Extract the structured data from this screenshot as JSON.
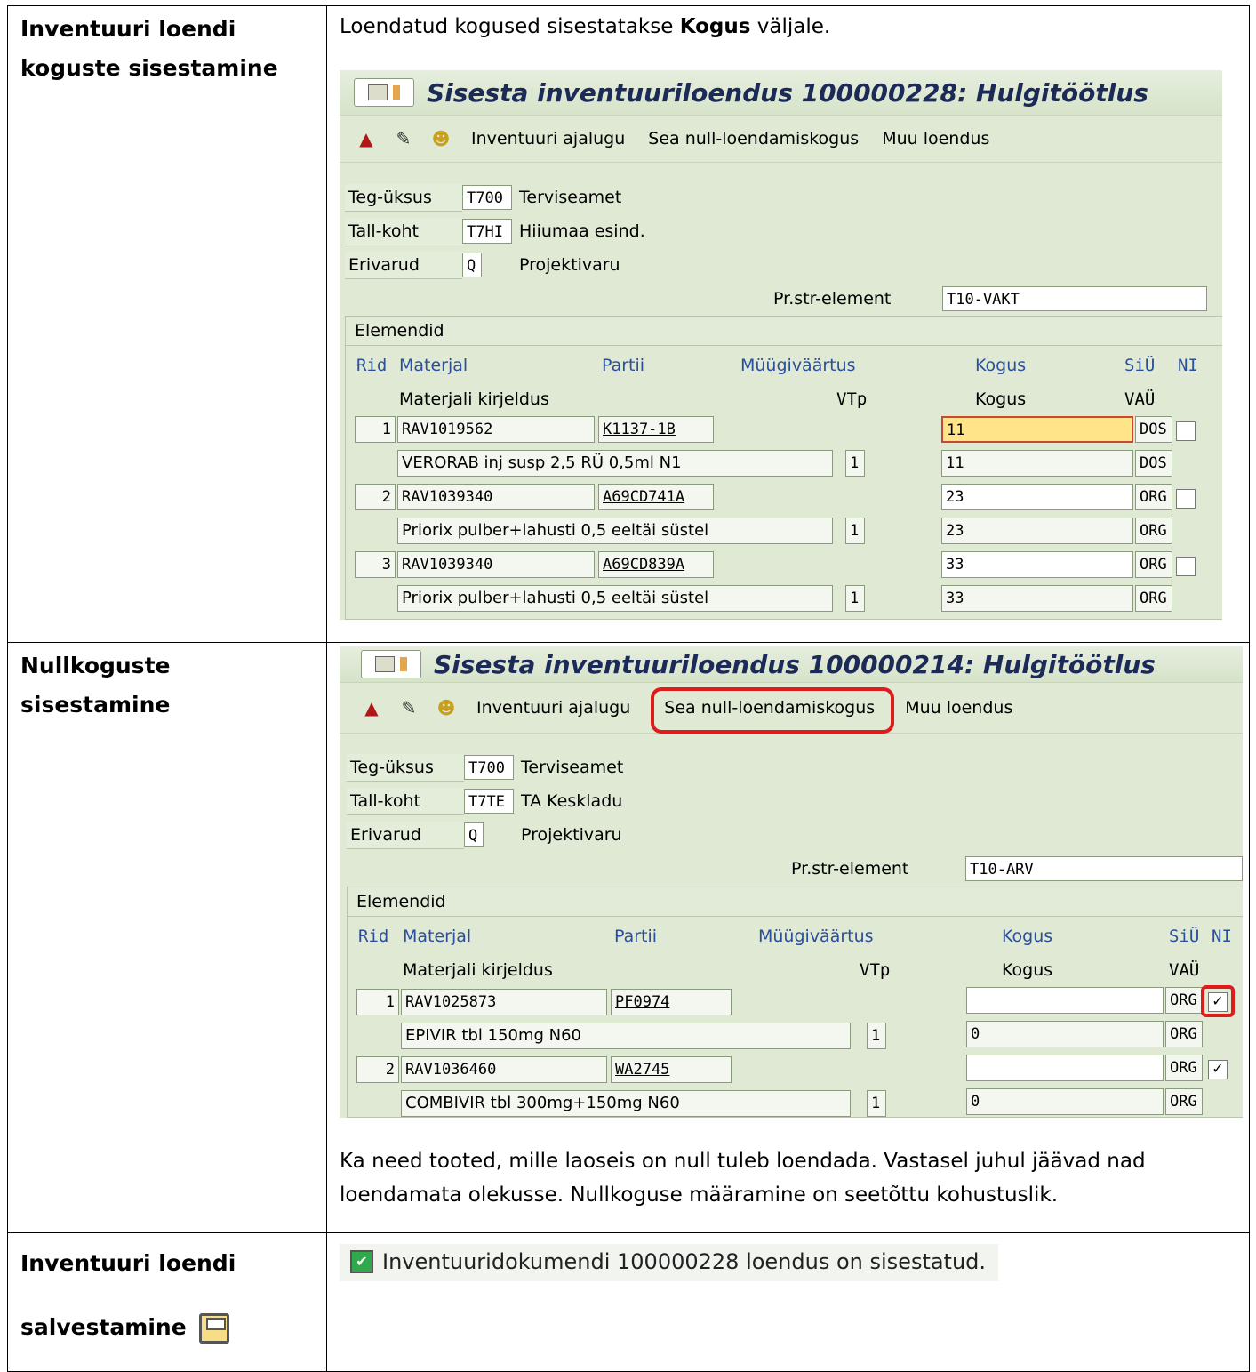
{
  "rows": [
    {
      "label": "Inventuuri loendi koguste sisestamine",
      "intro_pre": "Loendatud kogused sisestatakse ",
      "intro_bold": "Kogus",
      "intro_post": " väljale.",
      "screen": {
        "title": "Sisesta inventuuriloendus 100000228: Hulgitöötlus",
        "toolbar": [
          "Inventuuri ajalugu",
          "Sea null-loendamiskogus",
          "Muu loendus"
        ],
        "fields": [
          {
            "label": "Teg-üksus",
            "code": "T700",
            "text": "Terviseamet"
          },
          {
            "label": "Tall-koht",
            "code": "T7HI",
            "text": "Hiiumaa esind."
          },
          {
            "label": "Erivarud",
            "code": "Q",
            "text": "Projektivaru"
          }
        ],
        "psp_label": "Pr.str-element",
        "psp_value": "T10-VAKT",
        "group_title": "Elemendid",
        "col_headers": {
          "rid": "Rid",
          "materjal": "Materjal",
          "partii": "Partii",
          "muugi": "Müügiväärtus",
          "kogus": "Kogus",
          "siu": "SiÜ",
          "ni": "NI",
          "kirjeldus": "Materjali kirjeldus",
          "vtp": "VTp",
          "kogus2": "Kogus",
          "vau": "VAÜ"
        },
        "items": [
          {
            "rid": "1",
            "materjal": "RAV1019562",
            "partii": "K1137-1B",
            "kogus": "11",
            "siu": "DOS",
            "desc": "VERORAB inj susp 2,5 RÜ 0,5ml N1",
            "vtp": "1",
            "kogus2": "11",
            "vau": "DOS"
          },
          {
            "rid": "2",
            "materjal": "RAV1039340",
            "partii": "A69CD741A",
            "kogus": "23",
            "siu": "ORG",
            "desc": "Priorix pulber+lahusti 0,5 eeltäi süstel",
            "vtp": "1",
            "kogus2": "23",
            "vau": "ORG"
          },
          {
            "rid": "3",
            "materjal": "RAV1039340",
            "partii": "A69CD839A",
            "kogus": "33",
            "siu": "ORG",
            "desc": "Priorix pulber+lahusti 0,5 eeltäi süstel",
            "vtp": "1",
            "kogus2": "33",
            "vau": "ORG"
          }
        ]
      }
    },
    {
      "label": "Nullkoguste sisestamine",
      "screen": {
        "title": "Sisesta inventuuriloendus 100000214: Hulgitöötlus",
        "toolbar": [
          "Inventuuri ajalugu",
          "Sea null-loendamiskogus",
          "Muu loendus"
        ],
        "fields": [
          {
            "label": "Teg-üksus",
            "code": "T700",
            "text": "Terviseamet"
          },
          {
            "label": "Tall-koht",
            "code": "T7TE",
            "text": "TA Keskladu"
          },
          {
            "label": "Erivarud",
            "code": "Q",
            "text": "Projektivaru"
          }
        ],
        "psp_label": "Pr.str-element",
        "psp_value": "T10-ARV",
        "group_title": "Elemendid",
        "col_headers": {
          "rid": "Rid",
          "materjal": "Materjal",
          "partii": "Partii",
          "muugi": "Müügiväärtus",
          "kogus": "Kogus",
          "siu": "SiÜ",
          "ni": "NI",
          "kirjeldus": "Materjali kirjeldus",
          "vtp": "VTp",
          "kogus2": "Kogus",
          "vau": "VAÜ"
        },
        "items": [
          {
            "rid": "1",
            "materjal": "RAV1025873",
            "partii": "PF0974",
            "kogus": "",
            "siu": "ORG",
            "desc": "EPIVIR tbl 150mg N60",
            "vtp": "1",
            "kogus2": "0",
            "vau": "ORG",
            "ni": "✓"
          },
          {
            "rid": "2",
            "materjal": "RAV1036460",
            "partii": "WA2745",
            "kogus": "",
            "siu": "ORG",
            "desc": "COMBIVIR tbl 300mg+150mg N60",
            "vtp": "1",
            "kogus2": "0",
            "vau": "ORG",
            "ni": "✓"
          }
        ]
      },
      "note": "Ka need tooted, mille laoseis on null tuleb loendada. Vastasel juhul jäävad nad loendamata olekusse. Nullkoguse määramine on seetõttu kohustuslik."
    },
    {
      "label_line1": "Inventuuri loendi",
      "label_line2": "salvestamine",
      "message": "Inventuuridokumendi 100000228 loendus on sisestatud."
    }
  ]
}
